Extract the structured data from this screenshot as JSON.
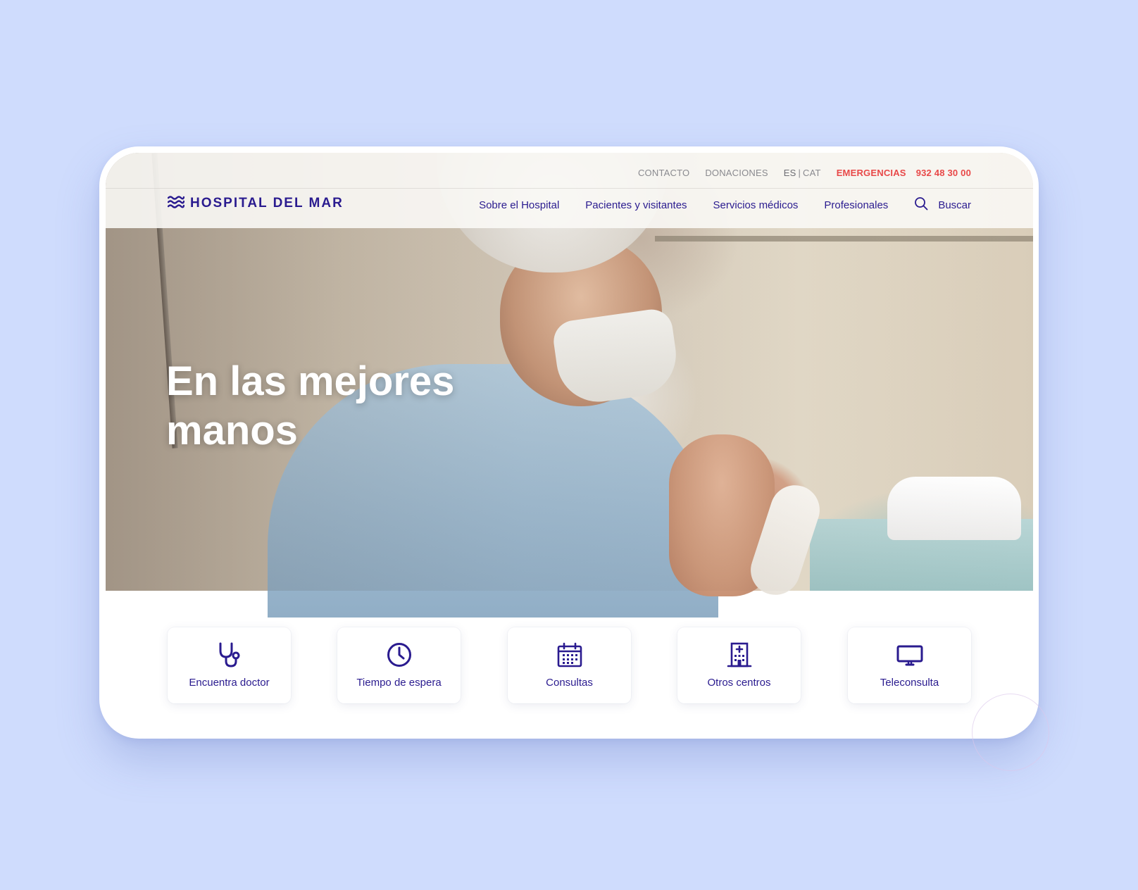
{
  "brand": {
    "name": "HOSPITAL DEL MAR",
    "primary_color": "#2a1b8f",
    "emergency_color": "#e84848",
    "background_color": "#cfdcfd"
  },
  "topbar": {
    "contacto": "CONTACTO",
    "donaciones": "DONACIONES",
    "lang_es": "ES",
    "lang_sep": "|",
    "lang_cat": "CAT",
    "emergencias": "EMERGENCIAS",
    "phone": "932 48 30 00"
  },
  "nav": {
    "items": [
      {
        "label": "Sobre el Hospital"
      },
      {
        "label": "Pacientes y visitantes"
      },
      {
        "label": "Servicios médicos"
      },
      {
        "label": "Profesionales"
      }
    ],
    "search_label": "Buscar",
    "search_icon": "search-icon"
  },
  "hero": {
    "title_line1": "En las mejores",
    "title_line2": "manos"
  },
  "quick_links": [
    {
      "label": "Encuentra doctor",
      "icon": "stethoscope-icon"
    },
    {
      "label": "Tiempo de espera",
      "icon": "clock-icon"
    },
    {
      "label": "Consultas",
      "icon": "calendar-icon"
    },
    {
      "label": "Otros centros",
      "icon": "hospital-building-icon"
    },
    {
      "label": "Teleconsulta",
      "icon": "monitor-icon"
    }
  ]
}
